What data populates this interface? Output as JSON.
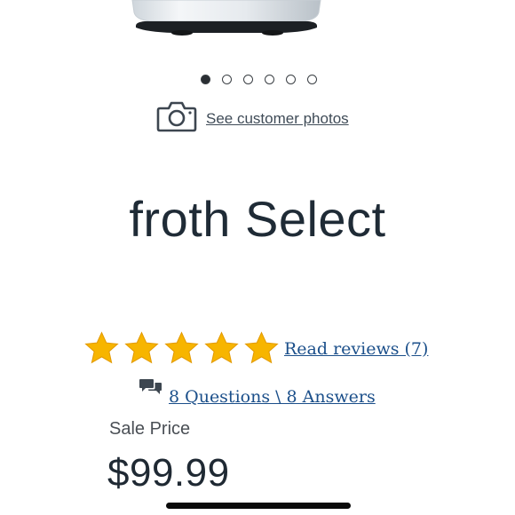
{
  "carousel": {
    "total_slides": 6,
    "active_index": 0
  },
  "customer_photos": {
    "icon": "camera-icon",
    "label": "See customer photos"
  },
  "product": {
    "title": "froth Select"
  },
  "rating": {
    "stars": 5,
    "max_stars": 5,
    "star_color": "#f7b500",
    "reviews_label": "Read reviews (7)"
  },
  "questions": {
    "icon": "chat-bubbles-icon",
    "label": "8 Questions \\ 8 Answers"
  },
  "pricing": {
    "sale_label": "Sale Price",
    "price": "$99.99"
  },
  "colors": {
    "link": "#1b4f8a",
    "text": "#1f2933"
  }
}
